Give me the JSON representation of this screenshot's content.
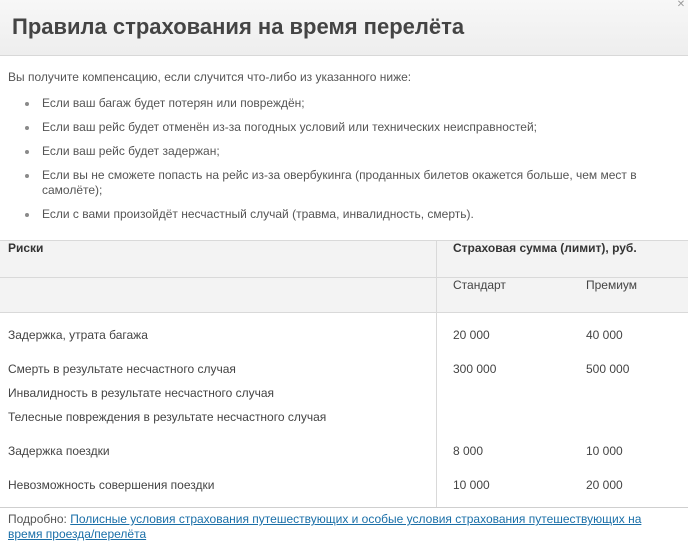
{
  "title": "Правила страхования на время перелёта",
  "intro": "Вы получите компенсацию, если случится что-либо из указанного ниже:",
  "bullets": [
    "Если ваш багаж будет потерян или повреждён;",
    "Если ваш рейс будет отменён из-за погодных условий или технических неисправностей;",
    "Если ваш рейс будет задержан;",
    "Если вы не сможете попасть на рейс из-за овербукинга (проданных билетов окажется больше, чем мест в самолёте);",
    "Если с вами произойдёт несчастный случай (травма, инвалидность, смерть)."
  ],
  "table": {
    "col_risks": "Риски",
    "col_sum": "Страховая сумма (лимит), руб.",
    "col_standard": "Стандарт",
    "col_premium": "Премиум",
    "rows": [
      {
        "risk": "Задержка, утрата багажа",
        "standard": "20 000",
        "premium": "40 000"
      },
      {
        "risk": "Смерть в результате несчастного случая",
        "standard": "300 000",
        "premium": "500 000"
      },
      {
        "risk": "Инвалидность в результате несчастного случая",
        "standard": "",
        "premium": ""
      },
      {
        "risk": "Телесные повреждения в результате несчастного случая",
        "standard": "",
        "premium": ""
      },
      {
        "risk": "Задержка поездки",
        "standard": "8 000",
        "premium": "10 000"
      },
      {
        "risk": "Невозможность совершения поездки",
        "standard": "10 000",
        "premium": "20 000"
      }
    ]
  },
  "footer": {
    "prefix": "Подробно:",
    "link_text": "Полисные условия страхования путешествующих и особые условия страхования путешествующих на время проезда/перелёта"
  }
}
